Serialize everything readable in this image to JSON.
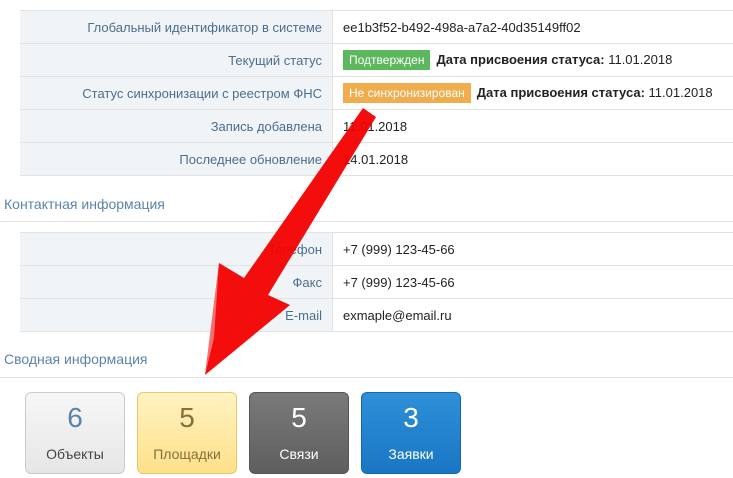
{
  "main_table": [
    {
      "label": "Глобальный идентификатор в системе",
      "value": "ee1b3f52-b492-498a-a7a2-40d35149ff02"
    },
    {
      "label": "Текущий статус",
      "badge": "Подтвержден",
      "extra_label": "Дата присвоения статуса:",
      "extra_value": "11.01.2018"
    },
    {
      "label": "Статус синхронизации с реестром ФНС",
      "badge": "Не синхронизирован",
      "extra_label": "Дата присвоения статуса:",
      "extra_value": "11.01.2018"
    },
    {
      "label": "Запись добавлена",
      "value": "11.01.2018"
    },
    {
      "label": "Последнее обновление",
      "value": "14.01.2018"
    }
  ],
  "contact_section": {
    "title": "Контактная информация"
  },
  "contact_table": [
    {
      "label": "Телефон",
      "value": "+7 (999) 123-45-66"
    },
    {
      "label": "Факс",
      "value": "+7 (999) 123-45-66"
    },
    {
      "label": "E-mail",
      "value": "exmaple@email.ru"
    }
  ],
  "summary_section": {
    "title": "Сводная информация"
  },
  "tiles": [
    {
      "count": "6",
      "label": "Объекты"
    },
    {
      "count": "5",
      "label": "Площадки"
    },
    {
      "count": "5",
      "label": "Связи"
    },
    {
      "count": "3",
      "label": "Заявки"
    }
  ],
  "colors": {
    "confirmed": "#5cb85c",
    "not_synced": "#f0ad4e",
    "arrow": "#f20000"
  }
}
